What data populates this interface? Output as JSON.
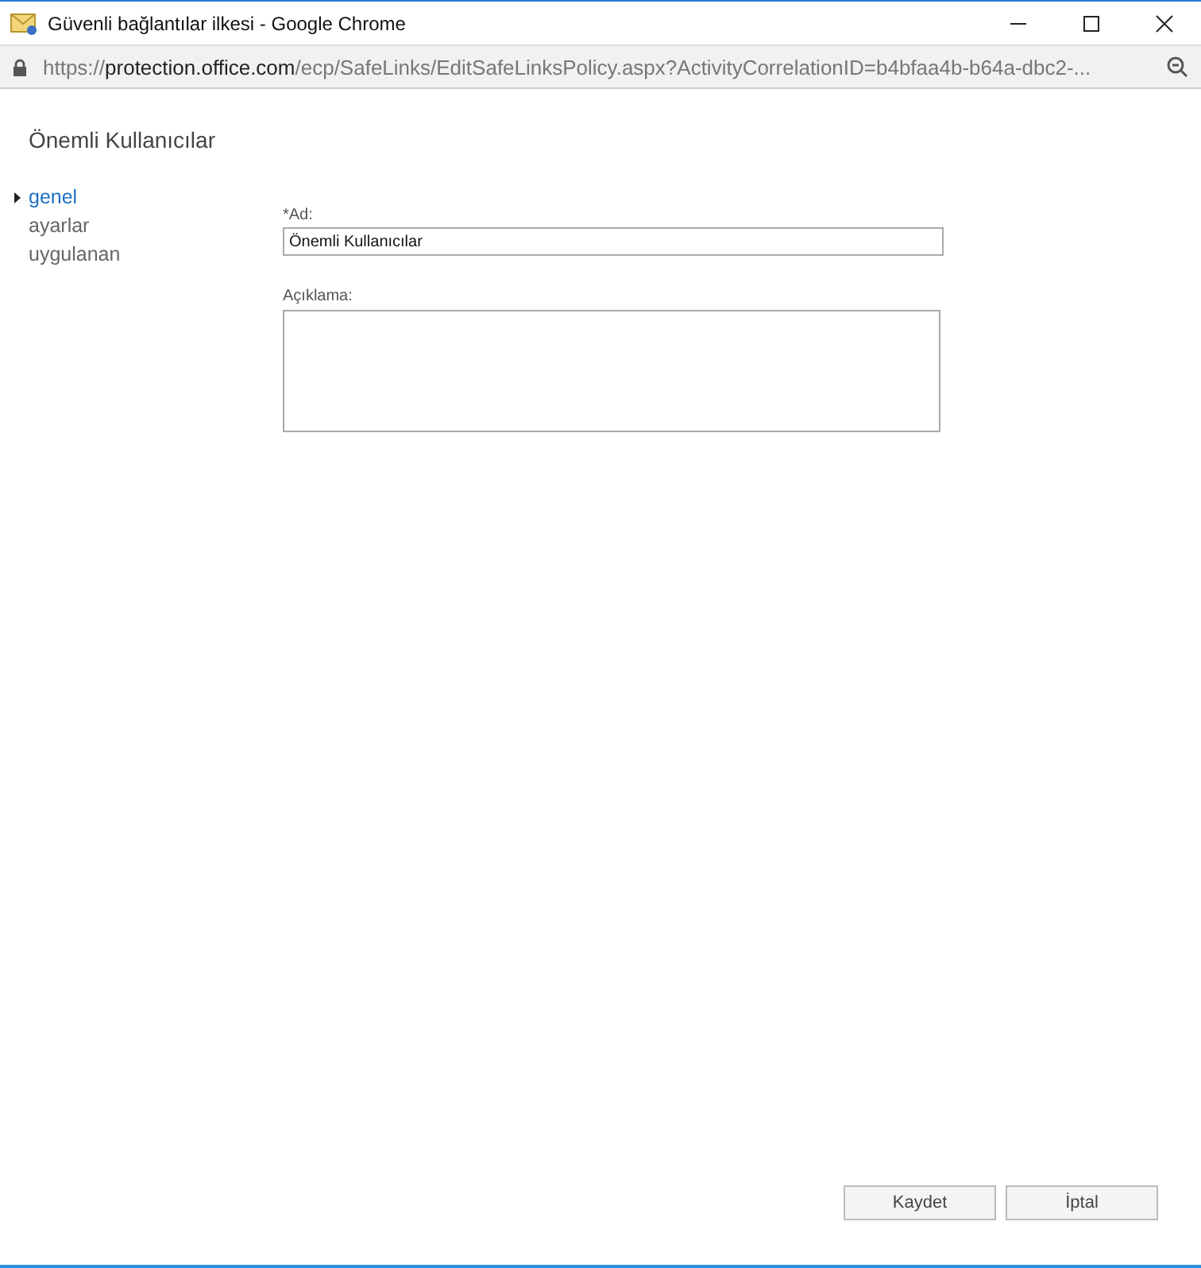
{
  "window": {
    "title": "Güvenli bağlantılar ilkesi - Google Chrome"
  },
  "address_bar": {
    "scheme": "https://",
    "host": "protection.office.com",
    "path": "/ecp/SafeLinks/EditSafeLinksPolicy.aspx?ActivityCorrelationID=b4bfaa4b-b64a-dbc2-..."
  },
  "heading": "Önemli Kullanıcılar",
  "nav": [
    {
      "label": "genel",
      "selected": true
    },
    {
      "label": "ayarlar",
      "selected": false
    },
    {
      "label": "uygulanan",
      "selected": false
    }
  ],
  "form": {
    "name_label": "*Ad:",
    "name_value": "Önemli Kullanıcılar",
    "description_label": "Açıklama:"
  },
  "buttons": [
    "Kaydet",
    "İptal"
  ]
}
